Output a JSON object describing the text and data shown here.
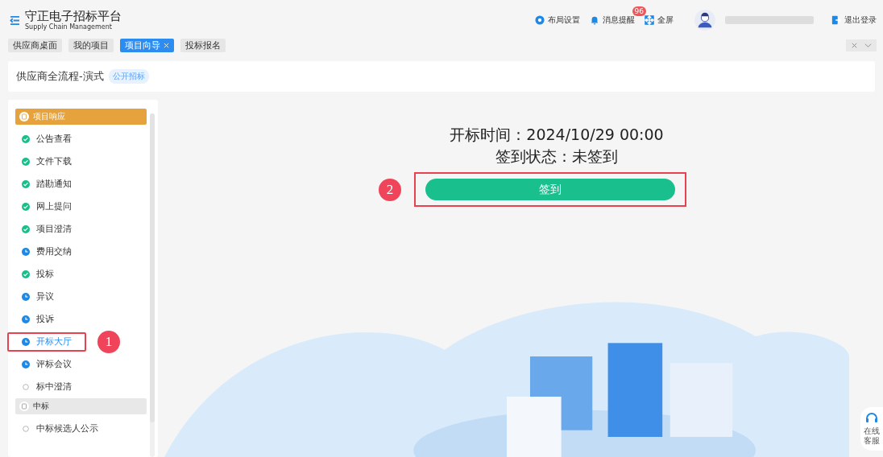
{
  "header": {
    "title": "守正电子招标平台",
    "subtitle": "Supply Chain Management",
    "actions": [
      {
        "kind": "layout",
        "label": "布局设置"
      },
      {
        "kind": "bell",
        "label": "消息提醒",
        "badge": "96"
      },
      {
        "kind": "fullscreen",
        "label": "全屏"
      }
    ],
    "logout": "退出登录"
  },
  "tabs": [
    {
      "label": "供应商桌面",
      "selected": false
    },
    {
      "label": "我的项目",
      "selected": false
    },
    {
      "label": "项目向导",
      "selected": true
    },
    {
      "label": "投标报名",
      "selected": false
    }
  ],
  "project": {
    "title": "供应商全流程-演式",
    "tag": "公开招标"
  },
  "sidebar": {
    "groups": [
      {
        "label": "项目响应",
        "active": true,
        "items": [
          {
            "label": "公告查看",
            "kind": "done",
            "selected": false
          },
          {
            "label": "文件下载",
            "kind": "done",
            "selected": false
          },
          {
            "label": "踏勘通知",
            "kind": "done",
            "selected": false
          },
          {
            "label": "网上提问",
            "kind": "done",
            "selected": false
          },
          {
            "label": "项目澄清",
            "kind": "done",
            "selected": false
          },
          {
            "label": "费用交纳",
            "kind": "pending",
            "selected": false
          },
          {
            "label": "投标",
            "kind": "done",
            "selected": false
          },
          {
            "label": "异议",
            "kind": "pending",
            "selected": false
          },
          {
            "label": "投诉",
            "kind": "pending",
            "selected": false
          },
          {
            "label": "开标大厅",
            "kind": "pending",
            "selected": true,
            "callout": "1"
          },
          {
            "label": "评标会议",
            "kind": "pending",
            "selected": false
          },
          {
            "label": "标中澄清",
            "kind": "todo",
            "selected": false
          }
        ]
      },
      {
        "label": "中标",
        "active": false,
        "items": [
          {
            "label": "中标候选人公示",
            "kind": "todo",
            "selected": false
          }
        ]
      }
    ]
  },
  "main": {
    "open_time": "开标时间：2024/10/29 00:00",
    "signin_status": "签到状态：未签到",
    "button": "签到",
    "button_callout": "2"
  },
  "support": {
    "label": "在线客服"
  }
}
